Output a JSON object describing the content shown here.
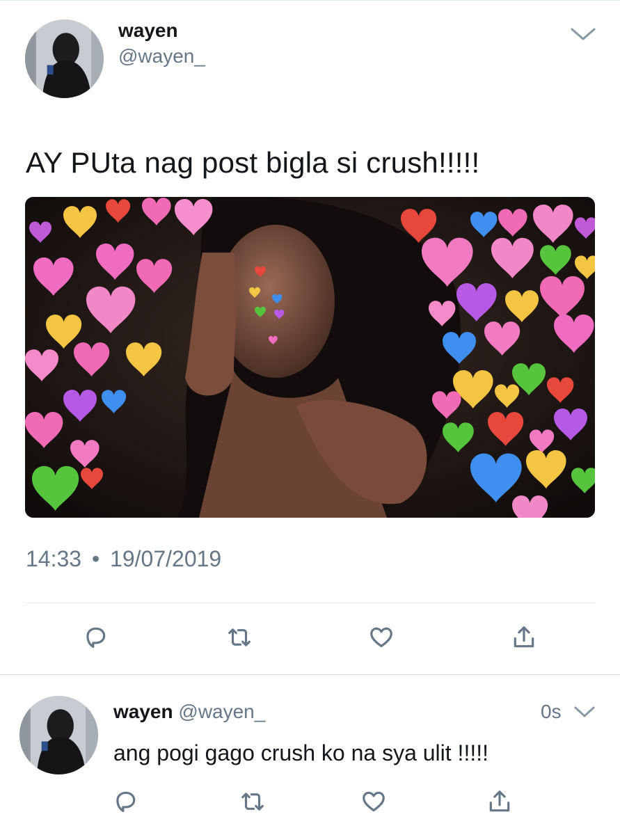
{
  "tweet": {
    "display_name": "wayen",
    "handle": "@wayen_",
    "text": "AY PUta nag post bigla si crush!!!!!",
    "time": "14:33",
    "separator": "•",
    "date": "19/07/2019",
    "menu_icon": "chevron-down-icon",
    "actions": [
      "reply-icon",
      "retweet-icon",
      "like-icon",
      "share-icon"
    ]
  },
  "reply": {
    "display_name": "wayen",
    "handle": "@wayen_",
    "time": "0s",
    "text": "ang pogi gago crush ko na sya ulit !!!!!",
    "actions": [
      "reply-icon",
      "retweet-icon",
      "like-icon",
      "share-icon"
    ]
  },
  "colors": {
    "text": "#14171a",
    "secondary": "#657786",
    "divider": "#e1e8ed"
  }
}
